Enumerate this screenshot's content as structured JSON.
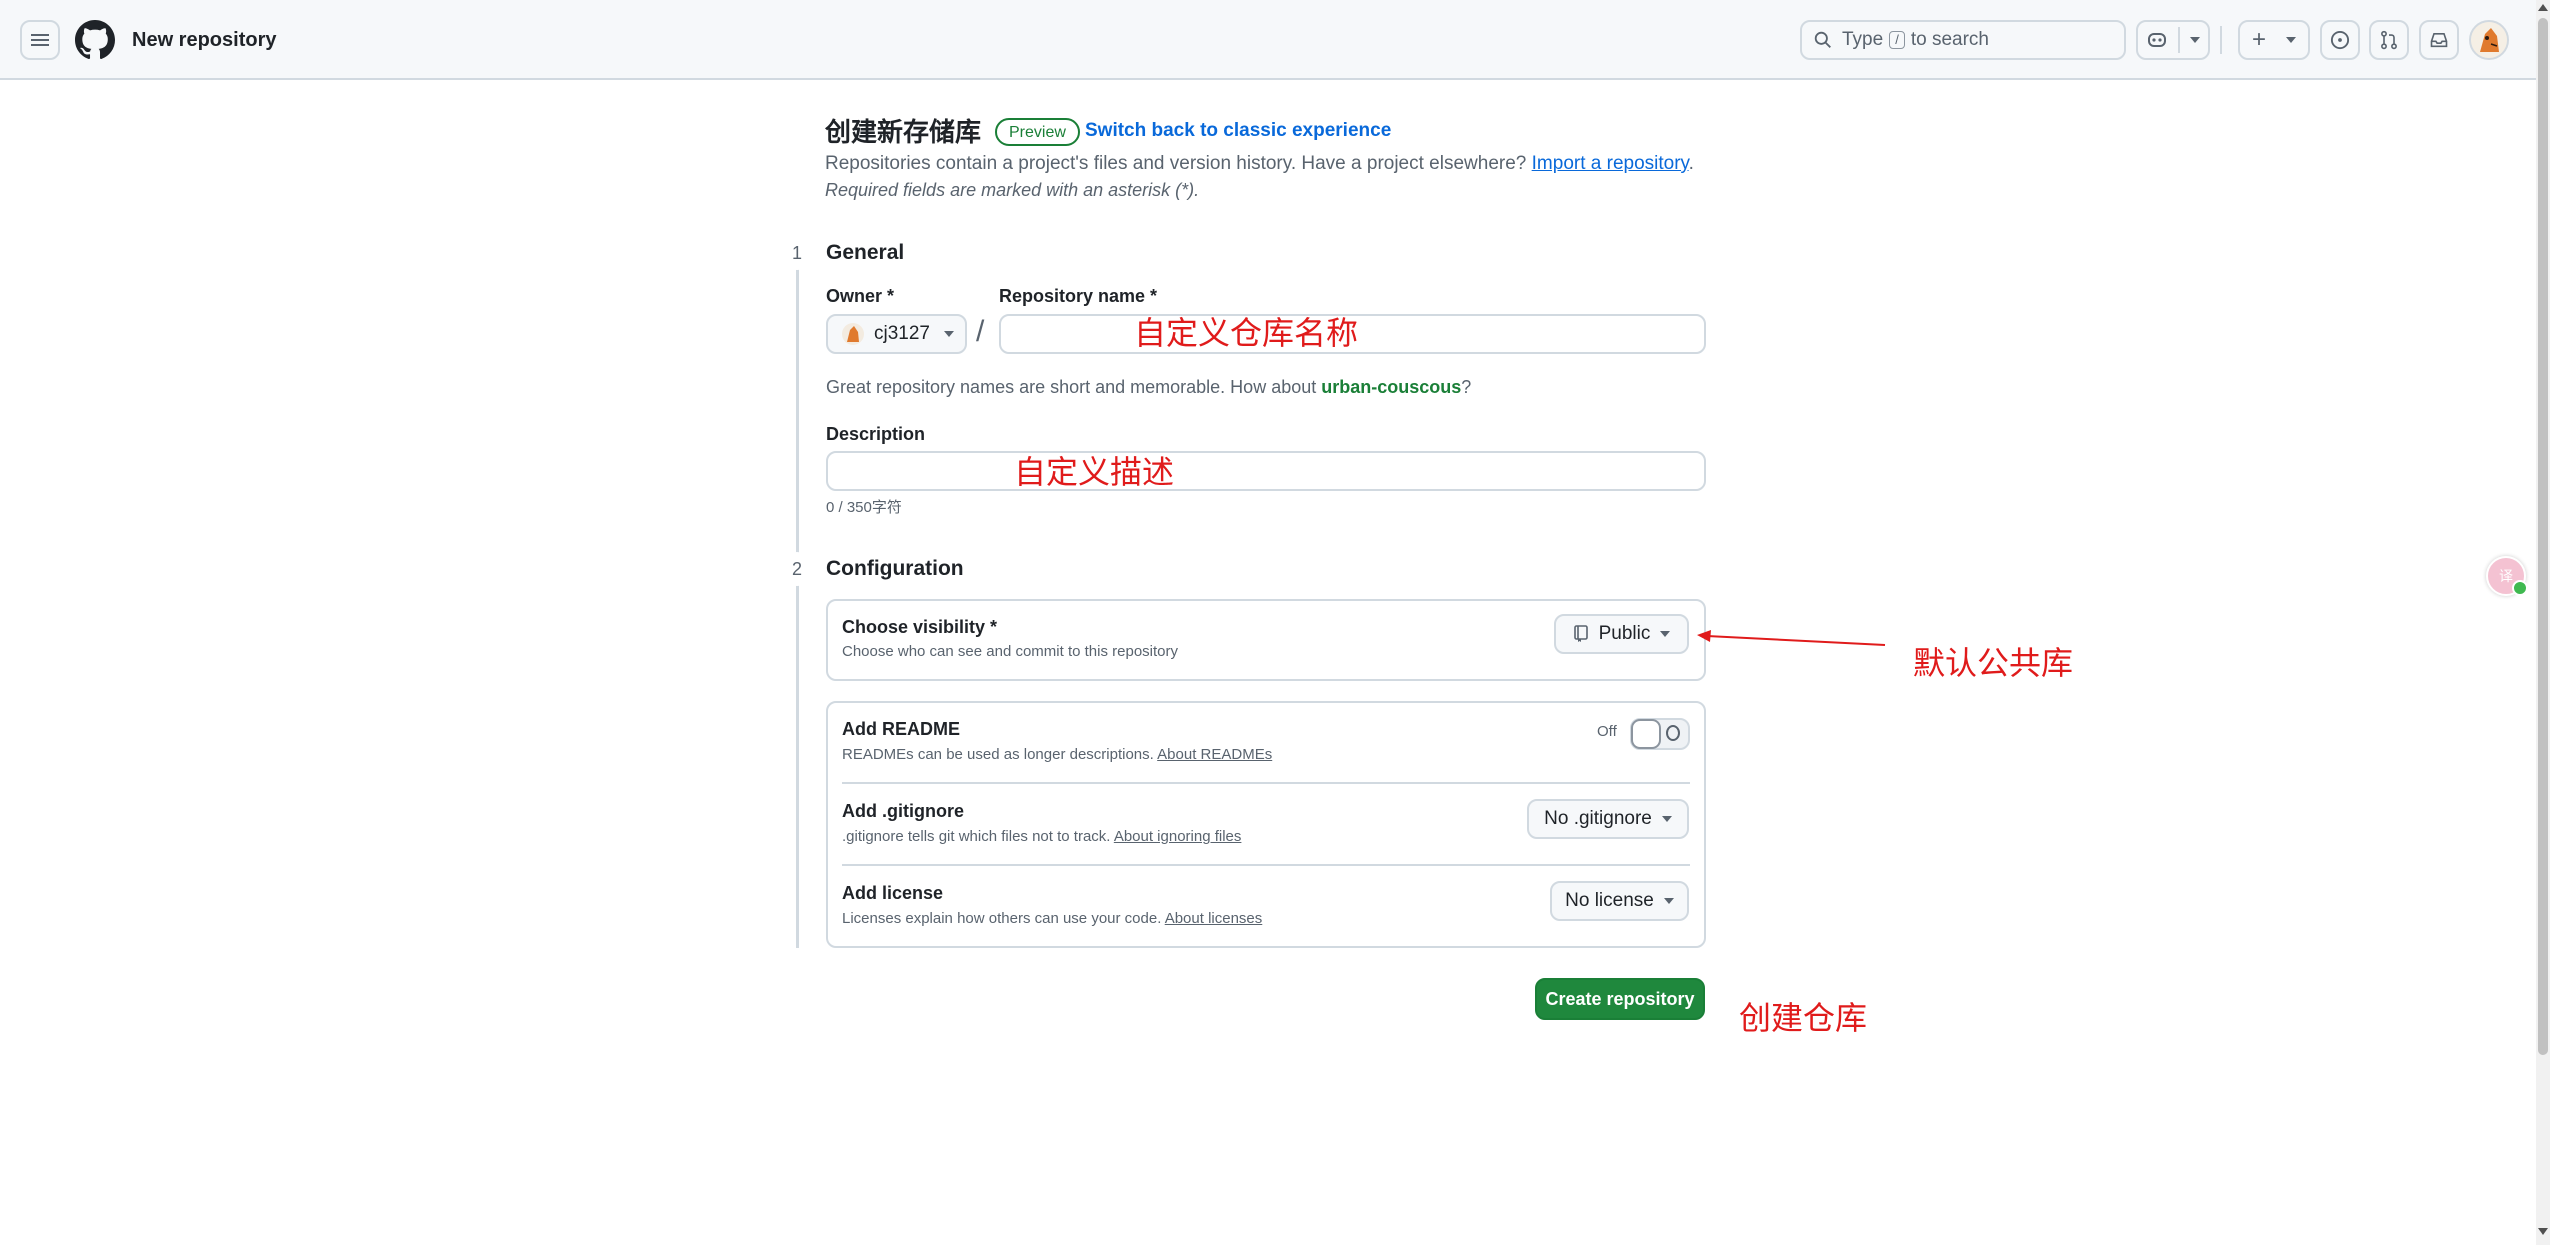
{
  "header": {
    "title": "New repository",
    "search": {
      "type_text": "Type",
      "key": "/",
      "to_search": "to search"
    }
  },
  "page": {
    "heading": "创建新存储库",
    "badge": "Preview",
    "switch_link": "Switch back to classic experience",
    "intro_text": "Repositories contain a project's files and version history. Have a project elsewhere?",
    "import_link": "Import a repository",
    "intro_end": ".",
    "required_note": "Required fields are marked with an asterisk (*)."
  },
  "general": {
    "step": "1",
    "title": "General",
    "owner_label": "Owner *",
    "owner_value": "cj3127",
    "slash": "/",
    "repo_name_label": "Repository name *",
    "repo_name_value": "",
    "hint_prefix": "Great repository names are short and memorable. How about",
    "hint_suggestion": "urban-couscous",
    "hint_suffix": "?",
    "description_label": "Description",
    "description_value": "",
    "char_counter": "0 / 350字符"
  },
  "configuration": {
    "step": "2",
    "title": "Configuration",
    "visibility": {
      "title": "Choose visibility *",
      "desc": "Choose who can see and commit to this repository",
      "value": "Public"
    },
    "readme": {
      "title": "Add README",
      "desc": "READMEs can be used as longer descriptions.",
      "link": "About READMEs",
      "toggle_label": "Off",
      "enabled": false
    },
    "gitignore": {
      "title": "Add .gitignore",
      "desc": ".gitignore tells git which files not to track.",
      "link": "About ignoring files",
      "value": "No .gitignore"
    },
    "license": {
      "title": "Add license",
      "desc": "Licenses explain how others can use your code.",
      "link": "About licenses",
      "value": "No license"
    }
  },
  "create_button": "Create repository",
  "annotations": {
    "repo_name": "自定义仓库名称",
    "description": "自定义描述",
    "visibility": "默认公共库",
    "create": "创建仓库",
    "color": "#e01b1b"
  },
  "colors": {
    "accent_blue": "#0969da",
    "success_green": "#1f883d",
    "border": "#d1d9e0"
  },
  "icons": [
    "menu-icon",
    "github-logo-icon",
    "search-icon",
    "copilot-icon",
    "plus-icon",
    "issues-icon",
    "pull-requests-icon",
    "inbox-icon",
    "repo-icon"
  ]
}
